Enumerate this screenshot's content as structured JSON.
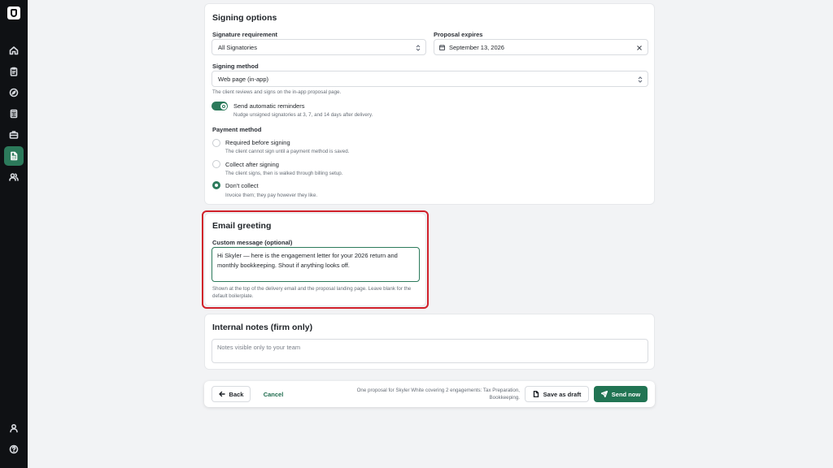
{
  "colors": {
    "accent": "#2c7a5b",
    "primary_button": "#217453",
    "highlight": "#d0202a",
    "sidebar": "#0f1114"
  },
  "sidebar": {
    "items": [
      {
        "icon": "home-icon"
      },
      {
        "icon": "clipboard-icon"
      },
      {
        "icon": "compass-icon"
      },
      {
        "icon": "calculator-icon"
      },
      {
        "icon": "briefcase-icon"
      },
      {
        "icon": "document-icon",
        "active": true
      },
      {
        "icon": "users-icon"
      }
    ],
    "bottom": [
      {
        "icon": "user-icon"
      },
      {
        "icon": "help-icon"
      }
    ]
  },
  "signing": {
    "title": "Signing options",
    "signature_requirement": {
      "label": "Signature requirement",
      "value": "All Signatories"
    },
    "proposal_expires": {
      "label": "Proposal expires",
      "value": "September 13, 2026"
    },
    "signing_method": {
      "label": "Signing method",
      "value": "Web page (in-app)",
      "help": "The client reviews and signs on the in-app proposal page."
    },
    "reminders": {
      "label": "Send automatic reminders",
      "help": "Nudge unsigned signatories at 3, 7, and 14 days after delivery.",
      "enabled": true
    },
    "payment": {
      "label": "Payment method",
      "options": [
        {
          "label": "Required before signing",
          "help": "The client cannot sign until a payment method is saved.",
          "selected": false
        },
        {
          "label": "Collect after signing",
          "help": "The client signs, then is walked through billing setup.",
          "selected": false
        },
        {
          "label": "Don't collect",
          "help": "Invoice them; they pay however they like.",
          "selected": true
        }
      ]
    }
  },
  "email": {
    "title": "Email greeting",
    "label": "Custom message (optional)",
    "value": "Hi Skyler — here is the engagement letter for your 2026 return and monthly bookkeeping. Shout if anything looks off.",
    "help": "Shown at the top of the delivery email and the proposal landing page. Leave blank for the default boilerplate."
  },
  "notes": {
    "title": "Internal notes (firm only)",
    "placeholder": "Notes visible only to your team"
  },
  "footer": {
    "back": "Back",
    "cancel": "Cancel",
    "summary": "One proposal for Skyler White covering 2 engagements: Tax Preparation, Bookkeeping.",
    "save_draft": "Save as draft",
    "send_now": "Send now"
  }
}
